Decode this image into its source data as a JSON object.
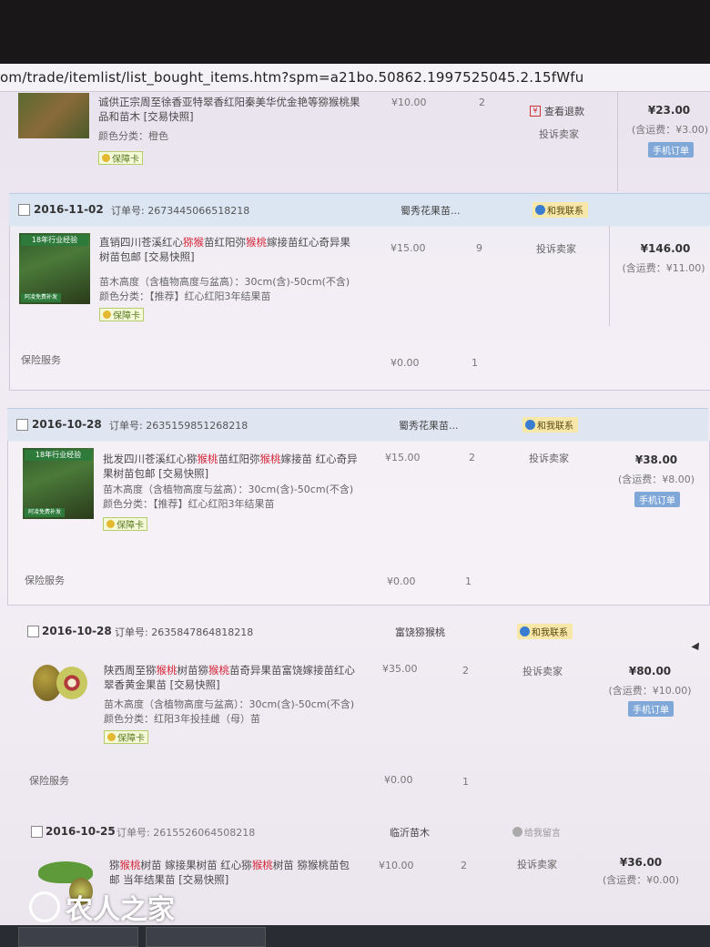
{
  "browser": {
    "url": "om/trade/itemlist/list_bought_items.htm?spm=a21bo.50862.1997525045.2.15fWfu"
  },
  "top_item": {
    "title": "诚供正宗周至徐香亚特翠香红阳秦美华优金艳等猕猴桃果品和苗木 [交易快照]",
    "attr": "颜色分类：橙色",
    "price": "¥10.00",
    "qty": "2",
    "refund": "查看退款",
    "complain": "投诉卖家",
    "total": "¥23.00",
    "shipping": "(含运费：¥3.00)",
    "mobile_badge": "手机订单",
    "insure": "保障卡"
  },
  "orders": [
    {
      "date": "2016-11-02",
      "order_no_label": "订单号:",
      "order_no": "2673445066518218",
      "shop": "蜀秀花果苗...",
      "contact": "和我联系",
      "item_title_a": "直销四川苍溪红心",
      "item_title_hl1": "猕猴",
      "item_title_b": "苗红阳弥",
      "item_title_hl2": "猴桃",
      "item_title_c": "嫁接苗红心奇异果树苗包邮 [交易快照]",
      "attr": "苗木高度（含植物高度与盆高）：30cm(含)-50cm(不含) 颜色分类：【推荐】红心红阳3年结果苗",
      "insure": "保障卡",
      "price": "¥15.00",
      "qty": "9",
      "complain": "投诉卖家",
      "total": "¥146.00",
      "shipping": "(含运费：¥11.00)",
      "service_label": "保险服务",
      "service_price": "¥0.00",
      "service_qty": "1",
      "thumb_banner": "18年行业经验",
      "thumb_footer": "阿凌免费补发"
    },
    {
      "date": "2016-10-28",
      "order_no_label": "订单号:",
      "order_no": "2635159851268218",
      "shop": "蜀秀花果苗...",
      "contact": "和我联系",
      "item_title_a": "批发四川苍溪红心猕",
      "item_title_hl1": "猴桃",
      "item_title_b": "苗红阳弥",
      "item_title_hl2": "猴桃",
      "item_title_c": "嫁接苗 红心奇异果树苗包邮 [交易快照]",
      "attr": "苗木高度（含植物高度与盆高）：30cm(含)-50cm(不含) 颜色分类：【推荐】红心红阳3年结果苗",
      "insure": "保障卡",
      "price": "¥15.00",
      "qty": "2",
      "complain": "投诉卖家",
      "total": "¥38.00",
      "shipping": "(含运费：¥8.00)",
      "mobile_badge": "手机订单",
      "service_label": "保险服务",
      "service_price": "¥0.00",
      "service_qty": "1",
      "thumb_banner": "18年行业经验",
      "thumb_footer": "阿凌免费补发"
    },
    {
      "date": "2016-10-28",
      "order_no_label": "订单号:",
      "order_no": "2635847864818218",
      "shop": "富饶猕猴桃",
      "contact": "和我联系",
      "item_title_a": "陕西周至猕",
      "item_title_hl1": "猴桃",
      "item_title_b": "树苗猕",
      "item_title_hl2": "猴桃",
      "item_title_c": "苗奇异果苗富饶嫁接苗红心翠香黄金果苗 [交易快照]",
      "attr": "苗木高度（含植物高度与盆高）：30cm(含)-50cm(不含) 颜色分类：红阳3年投挂雌（母）苗",
      "insure": "保障卡",
      "price": "¥35.00",
      "qty": "2",
      "complain": "投诉卖家",
      "total": "¥80.00",
      "shipping": "(含运费：¥10.00)",
      "mobile_badge": "手机订单",
      "service_label": "保险服务",
      "service_price": "¥0.00",
      "service_qty": "1"
    },
    {
      "date": "2016-10-25",
      "order_no_label": "订单号:",
      "order_no": "2615526064508218",
      "shop": "临沂苗木",
      "contact": "给我留言",
      "item_title_a": "猕",
      "item_title_hl1": "猴桃",
      "item_title_b": "树苗 嫁接果树苗 红心猕",
      "item_title_hl2": "猴桃",
      "item_title_c": "树苗 猕猴桃苗包邮 当年结果苗 [交易快照]",
      "price": "¥10.00",
      "qty": "2",
      "complain": "投诉卖家",
      "total": "¥36.00",
      "shipping": "(含运费：¥0.00)"
    }
  ],
  "watermark": "农人之家",
  "colors": {
    "highlight": "#d4283a",
    "order_header": "#dce6f3",
    "badge": "#7fa8d8",
    "contact_bg": "#f7e7a8"
  }
}
